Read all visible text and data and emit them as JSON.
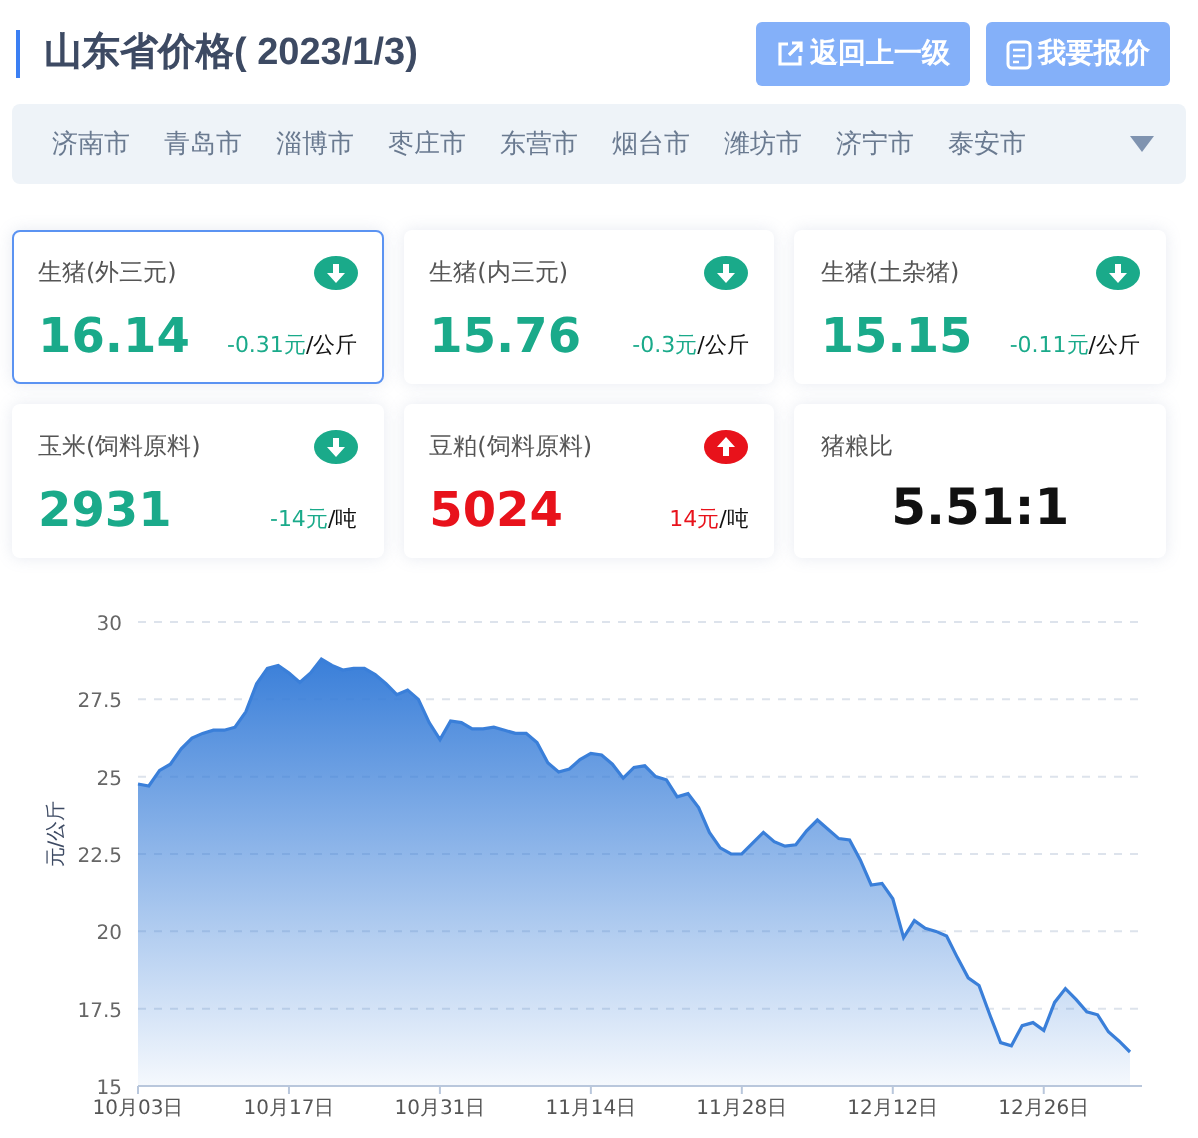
{
  "header": {
    "title": "山东省价格( 2023/1/3)",
    "buttons": [
      {
        "label": "返回上一级",
        "kind": "back"
      },
      {
        "label": "我要报价",
        "kind": "quote"
      }
    ]
  },
  "cities": [
    "济南市",
    "青岛市",
    "淄博市",
    "枣庄市",
    "东营市",
    "烟台市",
    "潍坊市",
    "济宁市",
    "泰安市"
  ],
  "cards": [
    {
      "kind": "fall",
      "name": "生猪(外三元)",
      "value": "16.14",
      "change": "-0.31元",
      "unit": "/公斤",
      "selected": true
    },
    {
      "kind": "fall",
      "name": "生猪(内三元)",
      "value": "15.76",
      "change": "-0.3元",
      "unit": "/公斤",
      "selected": false
    },
    {
      "kind": "fall",
      "name": "生猪(土杂猪)",
      "value": "15.15",
      "change": "-0.11元",
      "unit": "/公斤",
      "selected": false
    },
    {
      "kind": "fall",
      "name": "玉米(饲料原料)",
      "value": "2931",
      "change": "-14元",
      "unit": "/吨",
      "selected": false
    },
    {
      "kind": "rise",
      "name": "豆粕(饲料原料)",
      "value": "5024",
      "change": "14元",
      "unit": "/吨",
      "selected": false
    },
    {
      "kind": "ratio",
      "name": "猪粮比",
      "value": "5.51:1",
      "selected": false
    }
  ],
  "chart": {
    "chart_data": {
      "type": "area",
      "ylabel": "元/公斤",
      "categories": [
        "10月03日",
        null,
        null,
        null,
        null,
        null,
        null,
        null,
        null,
        null,
        null,
        null,
        null,
        null,
        "10月17日",
        null,
        null,
        null,
        null,
        null,
        null,
        null,
        null,
        null,
        null,
        null,
        null,
        null,
        "10月31日",
        null,
        null,
        null,
        null,
        null,
        null,
        null,
        null,
        null,
        null,
        null,
        null,
        null,
        "11月14日",
        null,
        null,
        null,
        null,
        null,
        null,
        null,
        null,
        null,
        null,
        null,
        null,
        null,
        "11月28日",
        null,
        null,
        null,
        null,
        null,
        null,
        null,
        null,
        null,
        null,
        null,
        null,
        null,
        "12月12日",
        null,
        null,
        null,
        null,
        null,
        null,
        null,
        null,
        null,
        null,
        null,
        null,
        null,
        "12月26日",
        null,
        null,
        null,
        null,
        null,
        null,
        null,
        null
      ],
      "series": [
        {
          "color": "#3a7fd9",
          "values": [
            24.76,
            24.7,
            25.2,
            25.4,
            25.9,
            26.25,
            26.4,
            26.5,
            26.5,
            26.6,
            27.1,
            28.0,
            28.5,
            28.6,
            28.35,
            28.05,
            28.35,
            28.8,
            28.6,
            28.45,
            28.5,
            28.5,
            28.3,
            28.0,
            27.65,
            27.8,
            27.5,
            26.75,
            26.2,
            26.8,
            26.75,
            26.55,
            26.55,
            26.6,
            26.5,
            26.4,
            26.4,
            26.1,
            25.45,
            25.15,
            25.25,
            25.55,
            25.75,
            25.7,
            25.4,
            24.95,
            25.3,
            25.35,
            25.0,
            24.9,
            24.35,
            24.45,
            24.0,
            23.2,
            22.7,
            22.5,
            22.5,
            22.85,
            23.2,
            22.9,
            22.75,
            22.8,
            23.25,
            23.6,
            23.3,
            23.0,
            22.95,
            22.3,
            21.5,
            21.55,
            21.05,
            19.8,
            20.35,
            20.1,
            20.0,
            19.85,
            19.15,
            18.5,
            18.25,
            17.3,
            16.4,
            16.3,
            16.95,
            17.05,
            16.8,
            17.7,
            18.15,
            17.8,
            17.4,
            17.3,
            16.75,
            16.45,
            16.1
          ]
        }
      ],
      "ylim": [
        15,
        30
      ],
      "grid": true,
      "yticks": [
        {
          "value": 15,
          "label": "15"
        },
        {
          "value": 17.5,
          "label": "17.5"
        },
        {
          "value": 20,
          "label": "20"
        },
        {
          "value": 22.5,
          "label": "22.5"
        },
        {
          "value": 25,
          "label": "25"
        },
        {
          "value": 27.5,
          "label": "27.5"
        },
        {
          "value": 30,
          "label": "30"
        }
      ]
    }
  }
}
